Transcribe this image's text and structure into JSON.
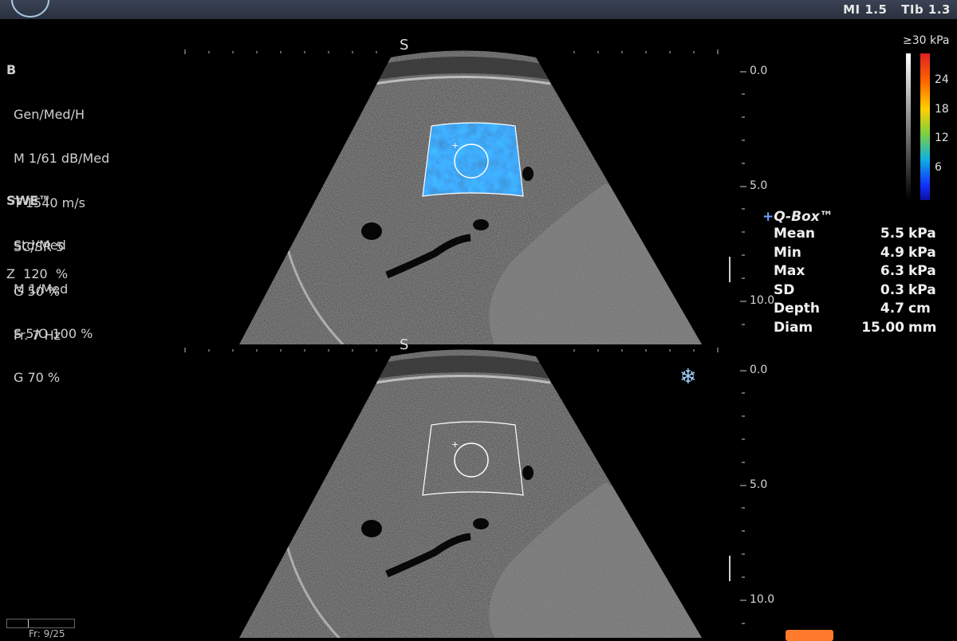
{
  "header": {
    "mi": "MI 1.5",
    "tib": "TIb 1.3"
  },
  "bmode": {
    "title": "B",
    "lines": [
      "Gen/Med/H",
      "M 1/61 dB/Med",
      "T 1540 m/s",
      "SC/SR 5",
      "G 50 %",
      "Fr. 7 Hz"
    ]
  },
  "swe": {
    "title": "SWE™",
    "lines": [
      "Std/Med",
      "M 1/Med",
      "S 5/O 100 %",
      "G 70 %"
    ]
  },
  "zoom": "Z  120  %",
  "depth_scale_top": [
    "0.0",
    "5.0",
    "10.0"
  ],
  "depth_scale_bottom": [
    "0.0",
    "5.0",
    "10.0"
  ],
  "colorbar": {
    "max_label": "≥30 kPa",
    "ticks": [
      "24",
      "18",
      "12",
      "6"
    ]
  },
  "qbox": {
    "plus": "+",
    "title": "Q-Box™",
    "rows": [
      {
        "label": "Mean",
        "value": "5.5",
        "unit": "kPa"
      },
      {
        "label": "Min",
        "value": "4.9",
        "unit": "kPa"
      },
      {
        "label": "Max",
        "value": "6.3",
        "unit": "kPa"
      },
      {
        "label": "SD",
        "value": "0.3",
        "unit": "kPa"
      },
      {
        "label": "Depth",
        "value": "4.7",
        "unit": "cm"
      },
      {
        "label": "Diam",
        "value": "15.00",
        "unit": "mm"
      }
    ]
  },
  "freeze_icon": "snowflake-icon",
  "frame_label": "Fr: 9/25",
  "colors": {
    "elasto_blue": "#1e5bff",
    "accent_orange": "#ff7a2a",
    "qbox_plus": "#6fa0ff"
  }
}
